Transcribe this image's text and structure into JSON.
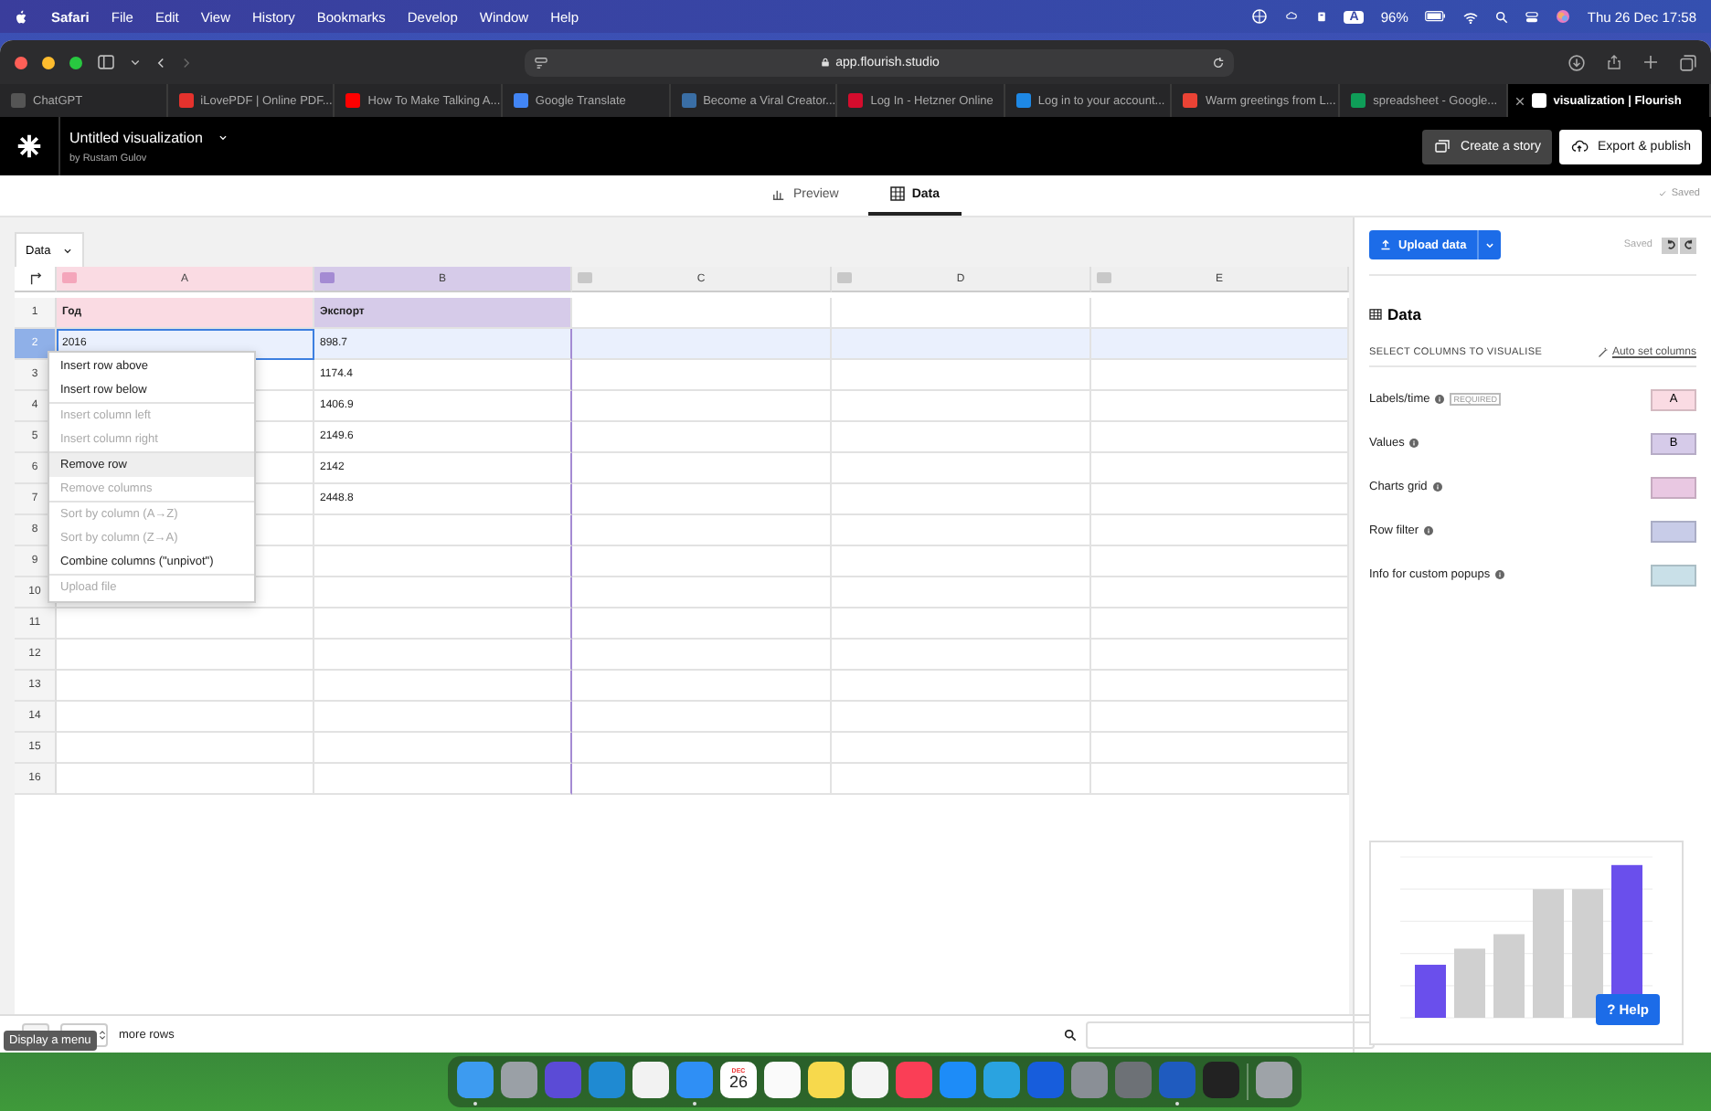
{
  "menubar": {
    "app": "Safari",
    "items": [
      "File",
      "Edit",
      "View",
      "History",
      "Bookmarks",
      "Develop",
      "Window",
      "Help"
    ],
    "input_source": "A",
    "battery": "96%",
    "clock": "Thu 26 Dec 17:58"
  },
  "browser": {
    "address": "app.flourish.studio",
    "tabs": [
      {
        "title": "ChatGPT",
        "selected": false,
        "color": "#555555"
      },
      {
        "title": "iLovePDF | Online PDF...",
        "selected": false,
        "color": "#e5322d"
      },
      {
        "title": "How To Make Talking A...",
        "selected": false,
        "color": "#ff0000"
      },
      {
        "title": "Google Translate",
        "selected": false,
        "color": "#4285f4"
      },
      {
        "title": "Become a Viral Creator...",
        "selected": false,
        "color": "#3a6ea5"
      },
      {
        "title": "Log In - Hetzner Online",
        "selected": false,
        "color": "#d50c2d"
      },
      {
        "title": "Log in to your account...",
        "selected": false,
        "color": "#1e88e5"
      },
      {
        "title": "Warm greetings from L...",
        "selected": false,
        "color": "#ea4335"
      },
      {
        "title": "spreadsheet - Google...",
        "selected": false,
        "color": "#0f9d58"
      },
      {
        "title": "visualization | Flourish",
        "selected": true,
        "color": "#ffffff"
      }
    ]
  },
  "app_header": {
    "title": "Untitled visualization",
    "author": "by Rustam Gulov",
    "story_button": "Create a story",
    "publish_button": "Export & publish"
  },
  "view_tabs": [
    {
      "label": "Preview",
      "selected": false
    },
    {
      "label": "Data",
      "selected": true
    }
  ],
  "save_status": "Saved",
  "sheet": {
    "tab": "Data",
    "columns": [
      {
        "letter": "A",
        "color": "#fadbe3"
      },
      {
        "letter": "B",
        "color": "#d6cbe9"
      },
      {
        "letter": "C",
        "color": "#efefef"
      },
      {
        "letter": "D",
        "color": "#efefef"
      },
      {
        "letter": "E",
        "color": "#efefef"
      }
    ],
    "rows": [
      {
        "number": "1",
        "selected": false,
        "cells": [
          "Год",
          "Экспорт"
        ]
      },
      {
        "number": "2",
        "selected": true,
        "cells": [
          "2016",
          "898.7"
        ]
      },
      {
        "number": "3",
        "selected": false,
        "cells": [
          "",
          "1174.4"
        ]
      },
      {
        "number": "4",
        "selected": false,
        "cells": [
          "",
          "1406.9"
        ]
      },
      {
        "number": "5",
        "selected": false,
        "cells": [
          "",
          "2149.6"
        ]
      },
      {
        "number": "6",
        "selected": false,
        "cells": [
          "",
          "2142"
        ]
      },
      {
        "number": "7",
        "selected": false,
        "cells": [
          "",
          "2448.8"
        ]
      },
      {
        "number": "8",
        "selected": false,
        "cells": []
      },
      {
        "number": "9",
        "selected": false,
        "cells": []
      },
      {
        "number": "10",
        "selected": false,
        "cells": []
      },
      {
        "number": "11",
        "selected": false,
        "cells": []
      },
      {
        "number": "12",
        "selected": false,
        "cells": []
      },
      {
        "number": "13",
        "selected": false,
        "cells": []
      },
      {
        "number": "14",
        "selected": false,
        "cells": []
      },
      {
        "number": "15",
        "selected": false,
        "cells": []
      },
      {
        "number": "16",
        "selected": false,
        "cells": []
      }
    ]
  },
  "context_menu": {
    "groups": [
      [
        {
          "label": "Insert row above",
          "disabled": false,
          "selected": false
        },
        {
          "label": "Insert row below",
          "disabled": false,
          "selected": false
        }
      ],
      [
        {
          "label": "Insert column left",
          "disabled": true,
          "selected": false
        },
        {
          "label": "Insert column right",
          "disabled": true,
          "selected": false
        }
      ],
      [
        {
          "label": "Remove row",
          "disabled": false,
          "selected": true
        },
        {
          "label": "Remove columns",
          "disabled": true,
          "selected": false
        }
      ],
      [
        {
          "label": "Sort by column (A→Z)",
          "disabled": true,
          "selected": false
        },
        {
          "label": "Sort by column (Z→A)",
          "disabled": true,
          "selected": false
        },
        {
          "label": "Combine columns (\"unpivot\")",
          "disabled": false,
          "selected": false
        }
      ],
      [
        {
          "label": "Upload file",
          "disabled": true,
          "selected": false
        }
      ]
    ]
  },
  "panel": {
    "upload_button": "Upload data",
    "saved": "Saved",
    "heading": "Data",
    "section_label": "SELECT COLUMNS TO VISUALISE",
    "auto_link": "Auto set columns",
    "bindings": [
      {
        "label": "Labels/time",
        "badge": "REQUIRED",
        "value": "A",
        "color": "#fadbe3"
      },
      {
        "label": "Values",
        "value": "B",
        "color": "#d6cbe9"
      },
      {
        "label": "Charts grid",
        "color": "#e9c8e2"
      },
      {
        "label": "Row filter",
        "color": "#c8cce8"
      },
      {
        "label": "Info for custom popups",
        "color": "#c9e0e8"
      }
    ],
    "help_button": "? Help"
  },
  "bottom_bar": {
    "tooltip": "Display a menu",
    "more_rows": "more rows"
  },
  "dock": [
    {
      "kind": "app",
      "color": "#3d9bf0",
      "running": true
    },
    {
      "kind": "app",
      "color": "#9aa0a6",
      "running": false
    },
    {
      "kind": "app",
      "color": "#5b4bd6",
      "running": false
    },
    {
      "kind": "app",
      "color": "#1f8ad2",
      "running": false
    },
    {
      "kind": "app",
      "color": "#f2f2f2",
      "running": false
    },
    {
      "kind": "app",
      "color": "#2f8ff5",
      "running": true
    },
    {
      "kind": "calendar",
      "month": "DEC",
      "day": "26",
      "color": "#ffffff",
      "running": false
    },
    {
      "kind": "app",
      "color": "#fafafa",
      "running": false
    },
    {
      "kind": "app",
      "color": "#f7d94c",
      "running": false
    },
    {
      "kind": "app",
      "color": "#f4f4f4",
      "running": false
    },
    {
      "kind": "app",
      "color": "#fa3e56",
      "running": false
    },
    {
      "kind": "app",
      "color": "#1d8cf8",
      "running": false
    },
    {
      "kind": "app",
      "color": "#2aa3e0",
      "running": false
    },
    {
      "kind": "app",
      "color": "#175ddc",
      "running": false
    },
    {
      "kind": "app",
      "color": "#8a8f96",
      "running": false
    },
    {
      "kind": "app",
      "color": "#6d7176",
      "running": false
    },
    {
      "kind": "app",
      "color": "#1f5bbf",
      "running": true
    },
    {
      "kind": "app",
      "color": "#222222",
      "running": false
    },
    {
      "kind": "trash",
      "color": "#9ea3a8",
      "running": false
    }
  ]
}
